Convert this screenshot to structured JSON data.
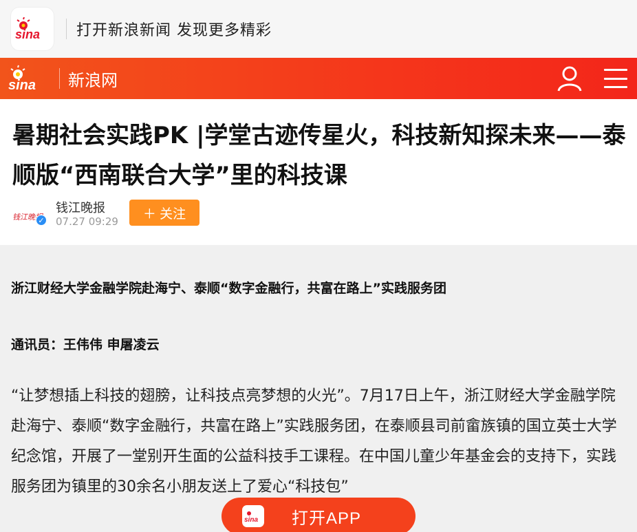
{
  "promo": {
    "logo_text": "sina",
    "text": "打开新浪新闻 发现更多精彩"
  },
  "header": {
    "logo_text": "sina",
    "site_name": "新浪网",
    "user_icon": "user-icon",
    "menu_icon": "hamburger-menu-icon"
  },
  "article": {
    "title": "暑期社会实践PK |学堂古迹传星火，科技新知探未来——泰顺版“西南联合大学”里的科技课",
    "author": {
      "name": "钱江晚报",
      "time": "07.27 09:29",
      "avatar_text": "钱江晚报",
      "verified": true
    },
    "follow_label": "＋ 关注",
    "org_line": "浙江财经大学金融学院赴海宁、泰顺“数字金融行，共富在路上”实践服务团",
    "reporter_line": "通讯员：王伟伟 申屠凌云",
    "body": "“让梦想插上科技的翅膀，让科技点亮梦想的火光”。7月17日上午，浙江财经大学金融学院赴海宁、泰顺“数字金融行，共富在路上”实践服务团，在泰顺县司前畲族镇的国立英士大学纪念馆，开展了一堂别开生面的公益科技手工课程。在中国儿童少年基金会的支持下，实践服务团为镇里的30余名小朋友送上了爱心“科技包”"
  },
  "open_app": {
    "label": "打开APP",
    "icon_text": "sina"
  },
  "colors": {
    "brand_red": "#f4411c",
    "follow_orange": "#ff8f1f",
    "verified_blue": "#2a8ef5"
  }
}
